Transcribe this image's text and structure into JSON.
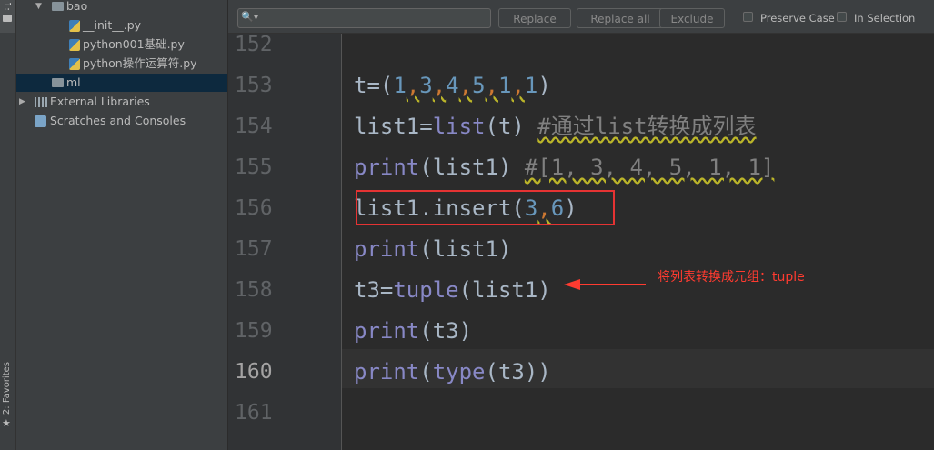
{
  "sidebar": {
    "top_tab": "1:",
    "favorites_label": "2: Favorites",
    "tree": [
      {
        "label": "bao"
      },
      {
        "label": "__init__.py"
      },
      {
        "label": "python001基础.py"
      },
      {
        "label": "python操作运算符.py"
      },
      {
        "label": "ml"
      },
      {
        "label": "External Libraries"
      },
      {
        "label": "Scratches and Consoles"
      }
    ]
  },
  "find_bar": {
    "search_value": "",
    "replace_label": "Replace",
    "replace_all_label": "Replace all",
    "exclude_label": "Exclude",
    "preserve_case_label": "Preserve Case",
    "in_selection_label": "In Selection"
  },
  "editor": {
    "line_numbers": [
      "152",
      "153",
      "154",
      "155",
      "156",
      "157",
      "158",
      "159",
      "160",
      "161"
    ],
    "current_line": "160",
    "code_lines": [
      "",
      "t=(1,3,4,5,1,1)",
      "list1=list(t) #通过list转换成列表",
      "print(list1) #[1, 3, 4, 5, 1, 1]",
      "list1.insert(3,6)",
      "print(list1)",
      "t3=tuple(list1)",
      "print(t3)",
      "print(type(t3))",
      ""
    ]
  },
  "annotation": {
    "text": "将列表转换成元组：tuple",
    "color": "#ff3b30"
  },
  "colors": {
    "background": "#2b2b2b",
    "panel": "#3c3f41",
    "number": "#6897bb",
    "builtin": "#8888c6",
    "comment": "#808080"
  }
}
